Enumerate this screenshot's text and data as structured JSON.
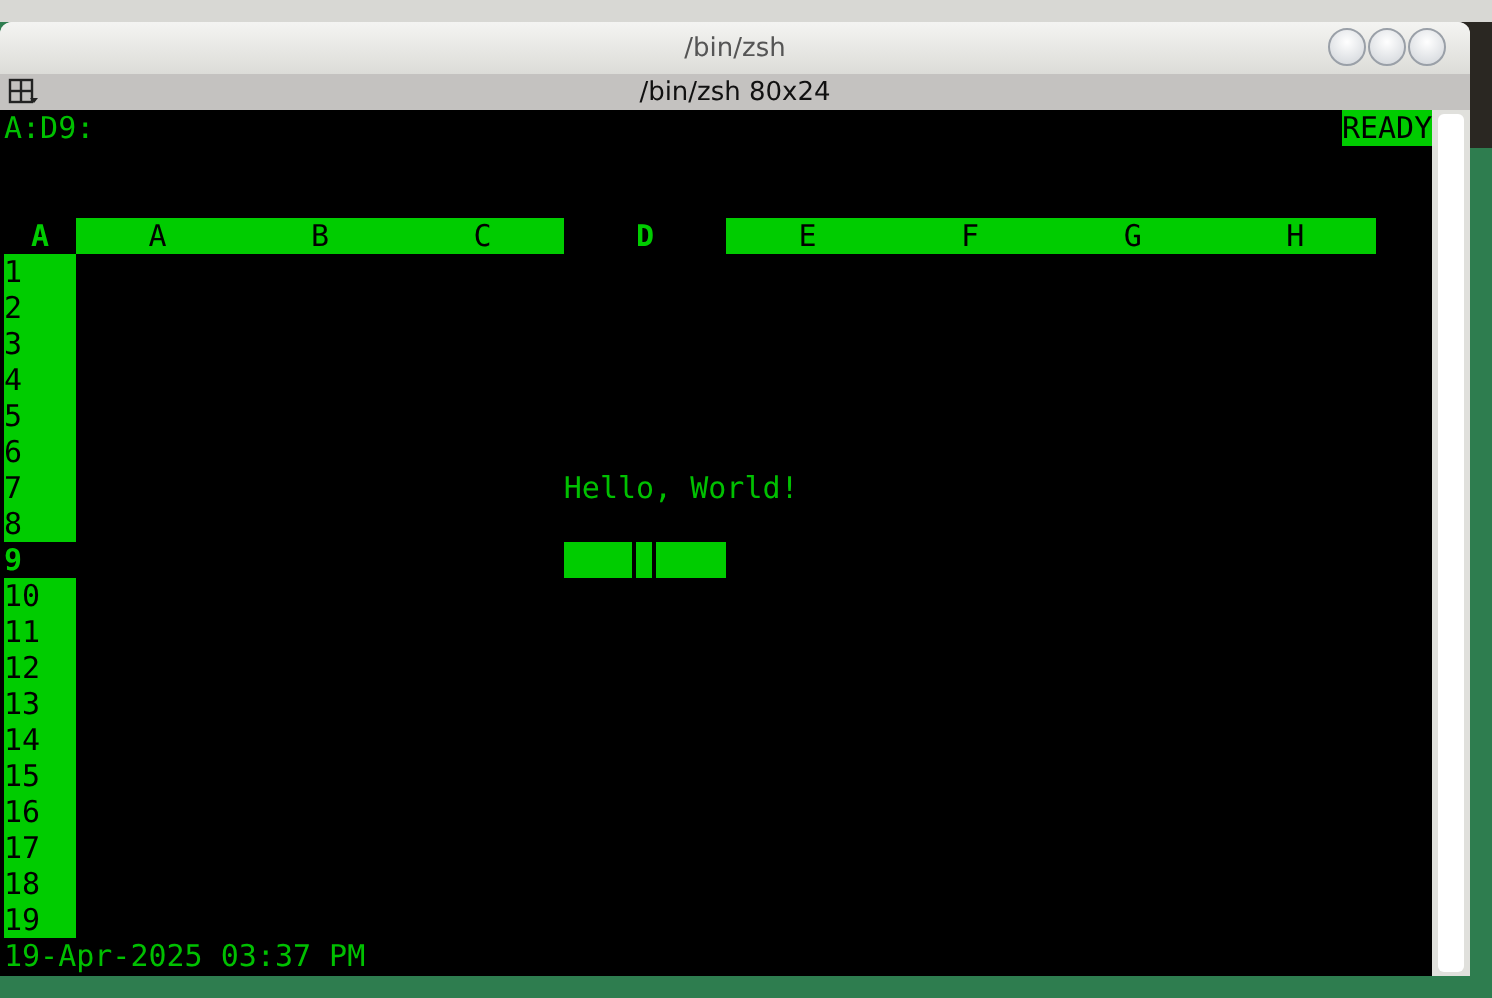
{
  "window": {
    "title": "/bin/zsh"
  },
  "tab": {
    "title": "/bin/zsh 80x24"
  },
  "sheet": {
    "cell_ref": "A:D9:",
    "mode": "READY",
    "corner": "A",
    "columns": [
      {
        "label": "A",
        "selected": false
      },
      {
        "label": "B",
        "selected": false
      },
      {
        "label": "C",
        "selected": false
      },
      {
        "label": "D",
        "selected": true
      },
      {
        "label": "E",
        "selected": false
      },
      {
        "label": "F",
        "selected": false
      },
      {
        "label": "G",
        "selected": false
      },
      {
        "label": "H",
        "selected": false
      }
    ],
    "rows": [
      {
        "label": "1",
        "selected": false
      },
      {
        "label": "2",
        "selected": false
      },
      {
        "label": "3",
        "selected": false
      },
      {
        "label": "4",
        "selected": false
      },
      {
        "label": "5",
        "selected": false
      },
      {
        "label": "6",
        "selected": false
      },
      {
        "label": "7",
        "selected": false,
        "cells": [
          null,
          null,
          null,
          "Hello, World!",
          null,
          null,
          null,
          null
        ]
      },
      {
        "label": "8",
        "selected": false
      },
      {
        "label": "9",
        "selected": true
      },
      {
        "label": "10",
        "selected": false
      },
      {
        "label": "11",
        "selected": false
      },
      {
        "label": "12",
        "selected": false
      },
      {
        "label": "13",
        "selected": false
      },
      {
        "label": "14",
        "selected": false
      },
      {
        "label": "15",
        "selected": false
      },
      {
        "label": "16",
        "selected": false
      },
      {
        "label": "17",
        "selected": false
      },
      {
        "label": "18",
        "selected": false
      },
      {
        "label": "19",
        "selected": false
      }
    ],
    "status": "19-Apr-2025 03:37 PM"
  }
}
